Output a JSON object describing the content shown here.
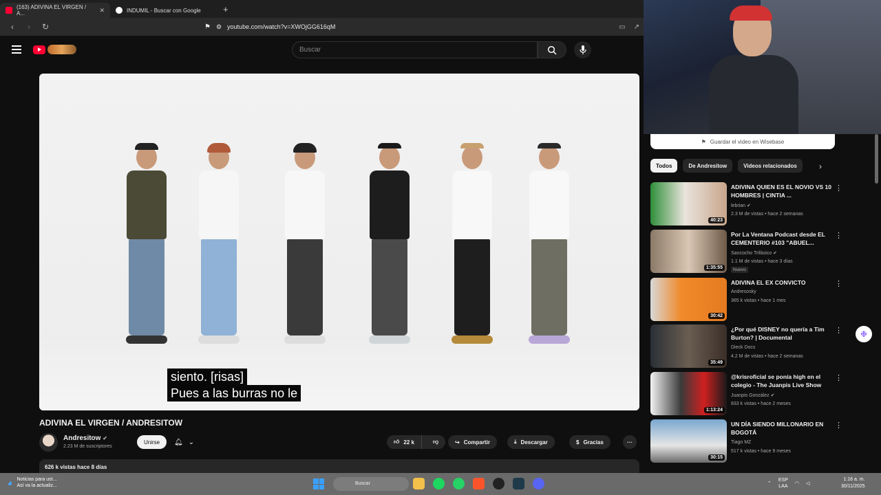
{
  "browser": {
    "tabs": [
      {
        "label": "(163) ADIVINA EL VIRGEN / A...",
        "active": true,
        "close": "✕"
      },
      {
        "label": "INDUMIL - Buscar con Google",
        "active": false
      }
    ],
    "new_tab": "+",
    "url": "youtube.com/watch?v=XWOjGG616qM"
  },
  "youtube": {
    "search_placeholder": "Buscar",
    "video": {
      "subtitle_line1": "siento. [risas]",
      "subtitle_line2": "Pues a las burras no le"
    },
    "title": "ADIVINA EL VIRGEN / ANDRESITOW",
    "channel": {
      "name": "Andresitow",
      "subscribers": "2.23 M de suscriptores",
      "join_label": "Unirse"
    },
    "actions": {
      "likes": "22 k",
      "share": "Compartir",
      "download": "Descargar",
      "thanks": "Gracias"
    },
    "description": "626 k vistas  hace 8 días"
  },
  "sidebar": {
    "banner": "Guardar el video en Wisebase",
    "chips": [
      "Todos",
      "De Andresitow",
      "Videos relacionados"
    ],
    "recommendations": [
      {
        "title": "ADIVINA QUIEN ES EL NOVIO VS 10 HOMBRES | CINTIA ...",
        "channel": "lebrian",
        "meta": "2.3 M de vistas • hace 2 semanas",
        "duration": "40:23",
        "badge": ""
      },
      {
        "title": "Por La Ventana Podcast desde EL CEMENTERIO #103 \"ABUEL...",
        "channel": "Sancocho Trifásico",
        "meta": "1.1 M de vistas • hace 3 días",
        "duration": "1:35:55",
        "badge": "Nuevo"
      },
      {
        "title": "ADIVINA EL EX CONVICTO",
        "channel": "Andresosky",
        "meta": "365 k vistas • hace 1 mes",
        "duration": "30:42",
        "badge": ""
      },
      {
        "title": "¿Por qué DISNEY no quería a Tim Burton? | Documental",
        "channel": "Dieck Docs",
        "meta": "4.2 M de vistas • hace 2 semanas",
        "duration": "35:49",
        "badge": ""
      },
      {
        "title": "@krisroficial se ponía high en el colegio - The Juanpis Live Show",
        "channel": "Juanpis González",
        "meta": "833 k vistas • hace 2 meses",
        "duration": "1:13:24",
        "badge": ""
      },
      {
        "title": "UN DÍA SIENDO MILLONARIO EN BOGOTÁ",
        "channel": "Tiago MZ",
        "meta": "517 k vistas • hace 9 meses",
        "duration": "30:15",
        "badge": ""
      }
    ]
  },
  "taskbar": {
    "news_line1": "Noticias para ust...",
    "news_line2": "Así va la actualiz...",
    "search": "Buscar",
    "lang1": "ESP",
    "lang2": "LAA",
    "time": "1:16 a. m.",
    "date": "30/11/2025"
  }
}
